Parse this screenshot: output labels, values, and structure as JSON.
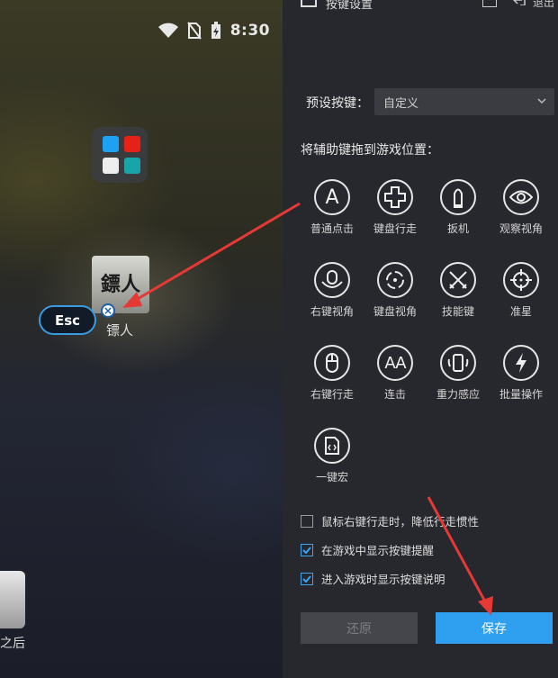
{
  "emulator": {
    "status_time": "8:30",
    "folder_app_colors": [
      "#1da1f2",
      "#e62117",
      "#222222",
      "#19a5a8"
    ],
    "app_biao": {
      "icon_text": "鏢人",
      "label": "镖人"
    },
    "esc_key": {
      "label": "Esc"
    },
    "bottom_app_label": "之后"
  },
  "panel": {
    "title": "按键设置",
    "exit_label": "退出",
    "preset": {
      "label": "预设按键：",
      "value": "自定义"
    },
    "drag_hint": "将辅助键拖到游戏位置：",
    "keys": [
      {
        "label": "普通点击",
        "icon": "letter-a-icon"
      },
      {
        "label": "键盘行走",
        "icon": "dpad-cross-icon"
      },
      {
        "label": "扳机",
        "icon": "bullet-icon"
      },
      {
        "label": "观察视角",
        "icon": "eye-icon"
      },
      {
        "label": "右键视角",
        "icon": "mouse-view-icon"
      },
      {
        "label": "键盘视角",
        "icon": "rotate-view-icon"
      },
      {
        "label": "技能键",
        "icon": "crossed-swords-icon"
      },
      {
        "label": "准星",
        "icon": "crosshair-icon"
      },
      {
        "label": "右键行走",
        "icon": "mouse-icon"
      },
      {
        "label": "连击",
        "icon": "double-a-icon"
      },
      {
        "label": "重力感应",
        "icon": "phone-rotate-icon"
      },
      {
        "label": "批量操作",
        "icon": "lightning-icon"
      },
      {
        "label": "一键宏",
        "icon": "macro-file-icon"
      }
    ],
    "options": [
      {
        "label": "鼠标右键行走时，降低行走惯性",
        "checked": false
      },
      {
        "label": "在游戏中显示按键提醒",
        "checked": true
      },
      {
        "label": "进入游戏时显示按键说明",
        "checked": true
      }
    ],
    "reset_label": "还原",
    "save_label": "保存"
  },
  "colors": {
    "accent": "#2fa0ef",
    "panel_bg": "#27282d",
    "annotation_arrow": "#e53935"
  }
}
